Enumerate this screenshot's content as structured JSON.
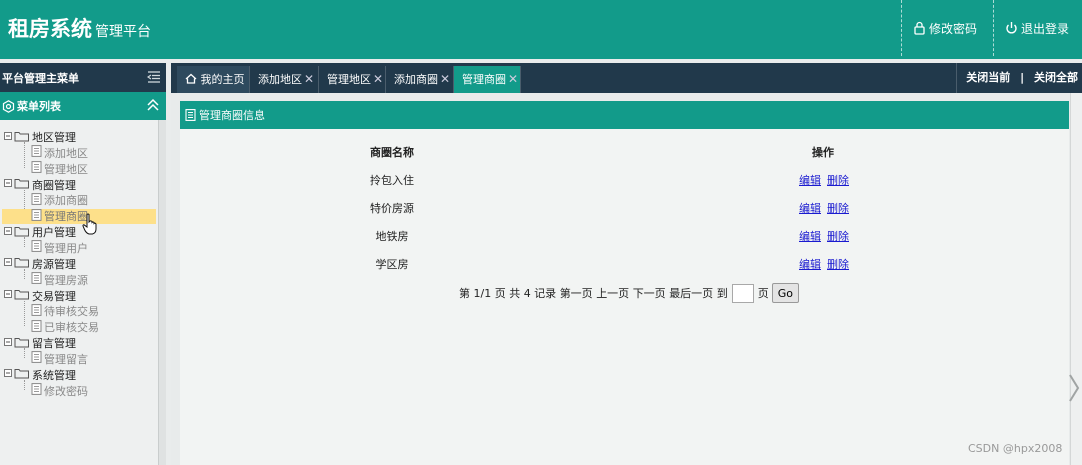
{
  "header": {
    "app_title": "租房系统",
    "app_subtitle": "管理平台",
    "change_password": "修改密码",
    "logout": "退出登录"
  },
  "sidebar": {
    "title": "平台管理主菜单",
    "menu_header": "菜单列表",
    "groups": [
      {
        "label": "地区管理",
        "items": [
          "添加地区",
          "管理地区"
        ]
      },
      {
        "label": "商圈管理",
        "items": [
          "添加商圈",
          "管理商圈"
        ]
      },
      {
        "label": "用户管理",
        "items": [
          "管理用户"
        ]
      },
      {
        "label": "房源管理",
        "items": [
          "管理房源"
        ]
      },
      {
        "label": "交易管理",
        "items": [
          "待审核交易",
          "已审核交易"
        ]
      },
      {
        "label": "留言管理",
        "items": [
          "管理留言"
        ]
      },
      {
        "label": "系统管理",
        "items": [
          "修改密码"
        ]
      }
    ],
    "selected_item": "管理商圈"
  },
  "tabs": {
    "items": [
      {
        "label": "我的主页",
        "closable": false,
        "active": false
      },
      {
        "label": "添加地区",
        "closable": true,
        "active": false
      },
      {
        "label": "管理地区",
        "closable": true,
        "active": false
      },
      {
        "label": "添加商圈",
        "closable": true,
        "active": false
      },
      {
        "label": "管理商圈",
        "closable": true,
        "active": true
      }
    ],
    "close_symbol": "✕",
    "close_current": "关闭当前",
    "separator": "|",
    "close_all": "关闭全部"
  },
  "panel": {
    "title": "管理商圈信息",
    "columns": [
      "商圈名称",
      "操作"
    ],
    "rows": [
      {
        "name": "拎包入住",
        "edit": "编辑",
        "delete": "删除"
      },
      {
        "name": "特价房源",
        "edit": "编辑",
        "delete": "删除"
      },
      {
        "name": "地铁房",
        "edit": "编辑",
        "delete": "删除"
      },
      {
        "name": "学区房",
        "edit": "编辑",
        "delete": "删除"
      }
    ]
  },
  "pager": {
    "summary": "第 1/1 页 共 4 记录",
    "first": "第一页",
    "prev": "上一页",
    "next": "下一页",
    "last": "最后一页",
    "goto_prefix": "到",
    "goto_value": "",
    "goto_suffix": "页",
    "go_button": "Go"
  },
  "watermark": "CSDN @hpx2008",
  "colors": {
    "teal": "#129b8a",
    "navy": "#21394b",
    "highlight": "#fde08a",
    "link": "#1a1ad0"
  }
}
